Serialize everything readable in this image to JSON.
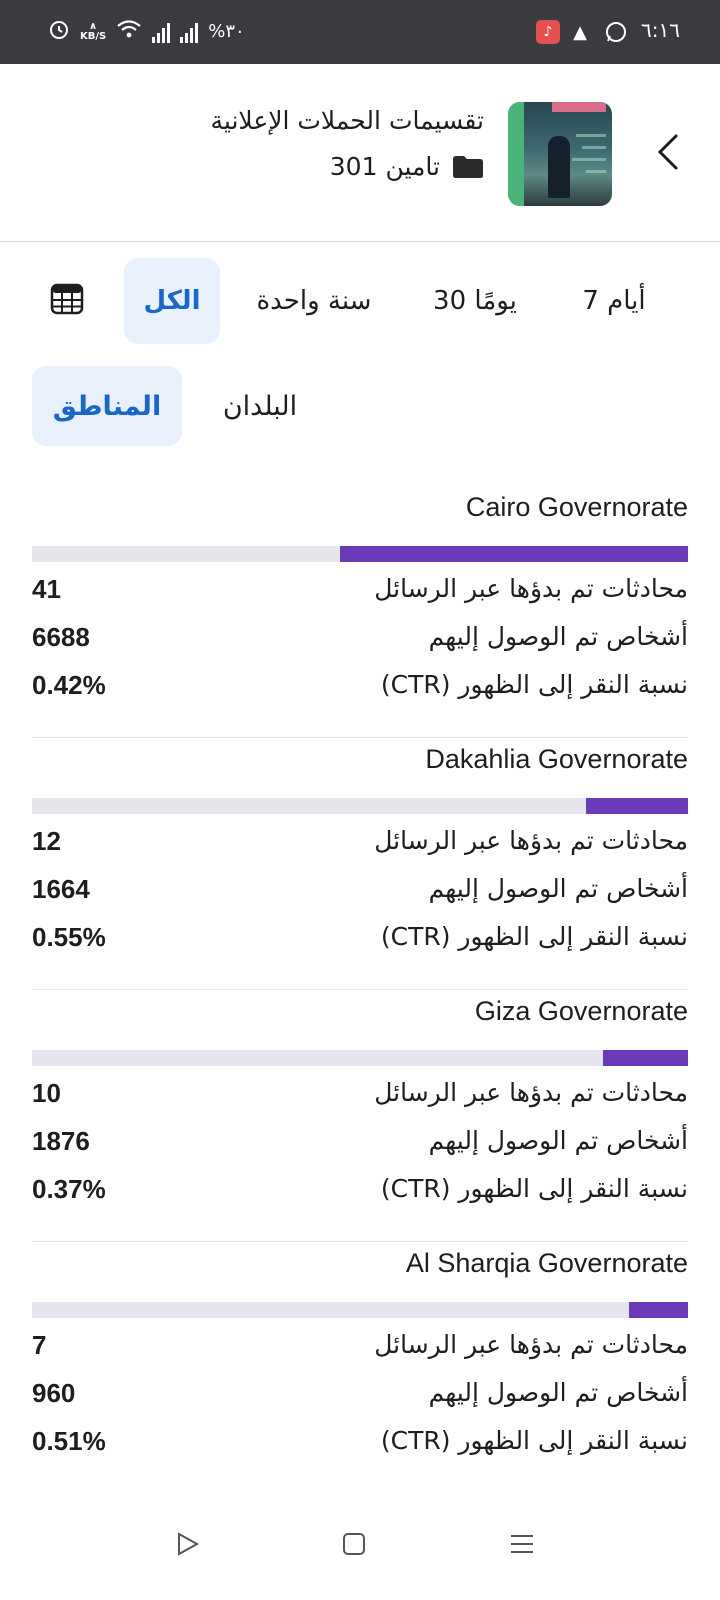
{
  "status_bar": {
    "time": "٦:١٦",
    "battery": "%٣٠",
    "net_speed_unit": "KB/S"
  },
  "header": {
    "title": "تقسيمات الحملات الإعلانية",
    "campaign_name": "تامين 301"
  },
  "period_tabs": [
    {
      "label": "7 أيام",
      "active": false
    },
    {
      "label": "30 يومًا",
      "active": false
    },
    {
      "label": "سنة واحدة",
      "active": false
    },
    {
      "label": "الكل",
      "active": true
    }
  ],
  "scope_tabs": [
    {
      "label": "المناطق",
      "active": true
    },
    {
      "label": "البلدان",
      "active": false
    }
  ],
  "metric_labels": {
    "conversations": "محادثات تم بدؤها عبر الرسائل",
    "reach": "أشخاص تم الوصول إليهم",
    "ctr": "نسبة النقر إلى الظهور (CTR)"
  },
  "regions": [
    {
      "name": "Cairo Governorate",
      "conversations": "41",
      "reach": "6688",
      "ctr": "0.42%",
      "share": 0.53
    },
    {
      "name": "Dakahlia Governorate",
      "conversations": "12",
      "reach": "1664",
      "ctr": "0.55%",
      "share": 0.155
    },
    {
      "name": "Giza Governorate",
      "conversations": "10",
      "reach": "1876",
      "ctr": "0.37%",
      "share": 0.13
    },
    {
      "name": "Al Sharqia Governorate",
      "conversations": "7",
      "reach": "960",
      "ctr": "0.51%",
      "share": 0.09
    }
  ],
  "colors": {
    "accent_blue": "#1a66c9",
    "active_tab_bg": "#e7f0fb",
    "bar_fill": "#6a3ab8",
    "bar_track": "#e4e6eb"
  },
  "icons": {
    "back": "chevron-left-icon",
    "folder": "folder-icon",
    "calendar": "calendar-icon",
    "nav_back": "play-triangle-icon",
    "nav_home": "square-icon",
    "nav_menu": "menu-lines-icon"
  }
}
